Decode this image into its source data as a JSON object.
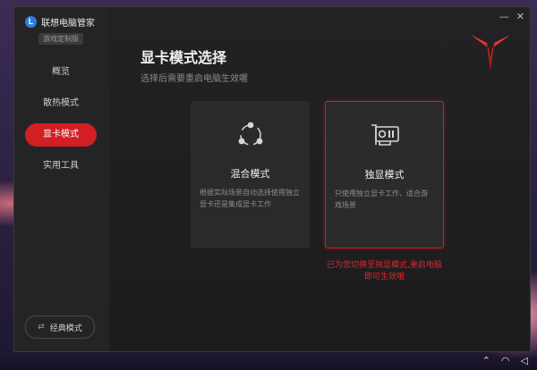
{
  "app": {
    "logo_letter": "L",
    "name": "联想电脑管家",
    "edition": "游戏定制版"
  },
  "sidebar": {
    "items": [
      {
        "label": "概览",
        "active": false
      },
      {
        "label": "散热模式",
        "active": false
      },
      {
        "label": "显卡模式",
        "active": true
      },
      {
        "label": "实用工具",
        "active": false
      }
    ],
    "classic_mode_label": "经典模式"
  },
  "main": {
    "title": "显卡模式选择",
    "subtitle": "选择后需要重启电脑生效喔",
    "cards": [
      {
        "title": "混合模式",
        "desc": "根据实际场景自动选择使用独立显卡还是集成显卡工作",
        "icon": "share-nodes-icon",
        "selected": false
      },
      {
        "title": "独显模式",
        "desc": "只使用独立显卡工作，适合游戏场景",
        "icon": "graphics-card-icon",
        "selected": true
      }
    ],
    "notice": "已为您切换至独显模式,重启电脑即可生效哦"
  },
  "window_controls": {
    "minimize": "—",
    "close": "✕"
  },
  "colors": {
    "accent": "#d11f24",
    "background": "#1d1d1f",
    "card": "#2a2a2c"
  }
}
